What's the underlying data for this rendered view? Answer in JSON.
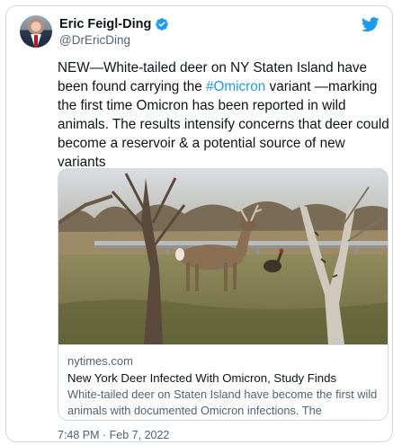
{
  "author": {
    "name": "Eric Feigl-Ding",
    "handle": "@DrEricDing",
    "verified_icon": "verified-badge-icon",
    "avatar_icon": "profile-avatar"
  },
  "tweet": {
    "text_before": "NEW—White-tailed deer on NY Staten Island have been found carrying the ",
    "hashtag": "#Omicron",
    "text_after": " variant —marking the first time Omicron has been reported in wild animals. The results intensify concerns that deer could become a reservoir & a potential source of new variants",
    "timestamp": "7:48 PM · Feb 7, 2022"
  },
  "card": {
    "domain": "nytimes.com",
    "headline": "New York Deer Infected With Omicron, Study Finds",
    "description": "White-tailed deer on Staten Island have become the first wild animals with documented Omicron infections. The coronavirus ..."
  },
  "colors": {
    "link": "#1d9bf0",
    "text": "#0f1419",
    "secondary": "#536471",
    "border": "#cfd9de"
  },
  "icons": {
    "logo": "twitter-bird-icon"
  }
}
